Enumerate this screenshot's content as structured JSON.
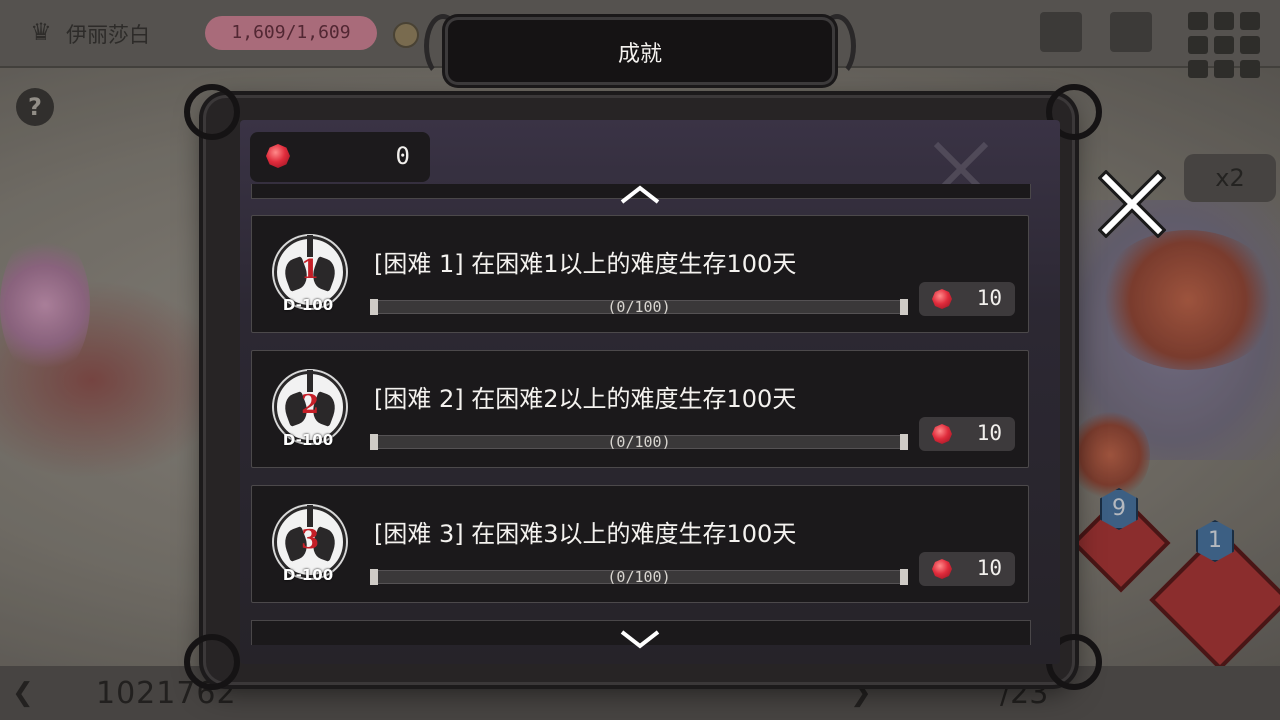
{
  "hud": {
    "player_name": "伊丽莎白",
    "hp": "1,609/1,609",
    "help": "?",
    "speed": "x2",
    "bottom_left_value": "1021762",
    "bottom_right_value": "/23"
  },
  "modal": {
    "title": "成就",
    "gem_count": "0",
    "achievements": [
      {
        "badge_number": "1",
        "badge_tag": "D-100",
        "title": "[困难 1] 在困难1以上的难度生存100天",
        "progress_text": "(0/100)",
        "progress": 0,
        "reward": "10"
      },
      {
        "badge_number": "2",
        "badge_tag": "D-100",
        "title": "[困难 2] 在困难2以上的难度生存100天",
        "progress_text": "(0/100)",
        "progress": 0,
        "reward": "10"
      },
      {
        "badge_number": "3",
        "badge_tag": "D-100",
        "title": "[困难 3] 在困难3以上的难度生存100天",
        "progress_text": "(0/100)",
        "progress": 0,
        "reward": "10"
      }
    ]
  },
  "icons": {
    "gem": "red-gem-icon",
    "close": "close-x-icon",
    "scroll_up": "chevron-up-icon",
    "scroll_down": "chevron-down-icon"
  },
  "colors": {
    "gem": "#e02c3c",
    "modal_bg": "#272425",
    "row_bg": "#1b191b",
    "text": "#f4f2ef"
  }
}
